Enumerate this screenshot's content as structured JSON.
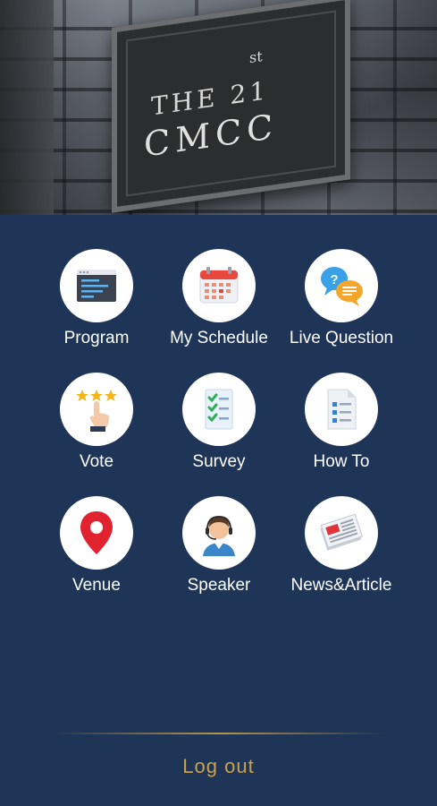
{
  "banner": {
    "sign_line1": "THE 21",
    "sign_sup": "st",
    "sign_line2": "CMCC"
  },
  "menu": [
    {
      "label": "Program",
      "icon": "program-icon"
    },
    {
      "label": "My Schedule",
      "icon": "calendar-icon"
    },
    {
      "label": "Live Question",
      "icon": "chat-bubbles-icon"
    },
    {
      "label": "Vote",
      "icon": "vote-stars-icon"
    },
    {
      "label": "Survey",
      "icon": "checklist-icon"
    },
    {
      "label": "How To",
      "icon": "document-list-icon"
    },
    {
      "label": "Venue",
      "icon": "location-pin-icon"
    },
    {
      "label": "Speaker",
      "icon": "speaker-headset-icon"
    },
    {
      "label": "News&Article",
      "icon": "newspaper-icon"
    }
  ],
  "footer": {
    "logout_label": "Log out"
  },
  "colors": {
    "background": "#1e3558",
    "accent_gold": "#c9a24e",
    "tile_circle": "#ffffff",
    "label_text": "#ffffff"
  }
}
